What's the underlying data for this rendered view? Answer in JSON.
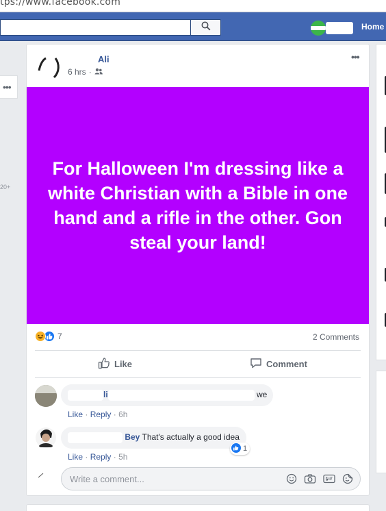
{
  "browser": {
    "url": "tps://www.facebook.com"
  },
  "topbar": {
    "home_label": "Home"
  },
  "post": {
    "author": "Ali",
    "time": "6 hrs",
    "audience_icon": "friends-icon",
    "menu_icon": "more-icon",
    "status_text": "For Halloween I'm dressing like a white Christian with a Bible in one hand and a rifle in the other. Gon steal your land!",
    "status_bg_color": "#b300ff",
    "reaction_count": "7",
    "comments_count": "2 Comments",
    "like_label": "Like",
    "comment_label": "Comment"
  },
  "comments": [
    {
      "name_fragment": "li",
      "text": "we",
      "like": "Like",
      "reply": "Reply",
      "time": "6h"
    },
    {
      "name": "Bey",
      "text": "That's actually a good idea",
      "like": "Like",
      "reply": "Reply",
      "time": "5h",
      "like_count": "1"
    }
  ],
  "composer": {
    "placeholder": "Write a comment..."
  },
  "sidebar": {
    "left_count": "20+"
  },
  "colors": {
    "brand": "#4267b2",
    "link": "#385898",
    "like_blue": "#1877f2"
  }
}
